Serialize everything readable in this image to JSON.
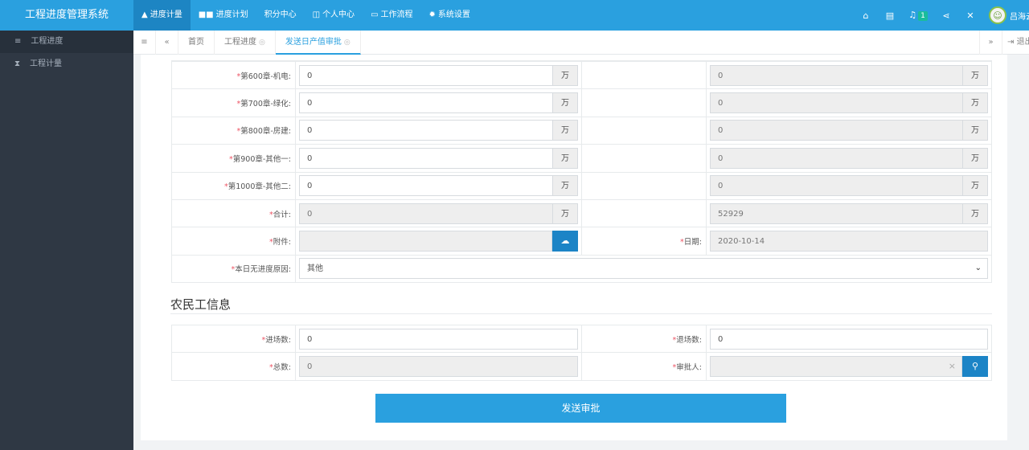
{
  "app": {
    "title": "工程进度管理系统"
  },
  "topnav": [
    {
      "label": "进度计量",
      "icon": "chart-icon",
      "glyph": "▲",
      "active": true
    },
    {
      "label": "进度计划",
      "icon": "grid-icon",
      "glyph": "■■",
      "active": false
    },
    {
      "label": "积分中心",
      "icon": "",
      "glyph": "",
      "active": false
    },
    {
      "label": "个人中心",
      "icon": "card-icon",
      "glyph": "◫",
      "active": false
    },
    {
      "label": "工作流程",
      "icon": "monitor-icon",
      "glyph": "▭",
      "active": false
    },
    {
      "label": "系统设置",
      "icon": "gear-icon",
      "glyph": "✹",
      "active": false
    }
  ],
  "header_right": {
    "notification_count": "1",
    "user_name": "吕海云"
  },
  "sidebar": {
    "items": [
      {
        "label": "工程进度",
        "icon": "list-icon",
        "glyph": "≡",
        "active": true
      },
      {
        "label": "工程计量",
        "icon": "hourglass-icon",
        "glyph": "⧗",
        "active": false
      }
    ]
  },
  "tabs": {
    "home": "首页",
    "items": [
      {
        "label": "工程进度",
        "active": false
      },
      {
        "label": "发送日产值审批",
        "active": true
      }
    ],
    "close_glyph": "◎",
    "logout": "退出"
  },
  "form": {
    "unit": "万",
    "rows": [
      {
        "label": "第600章-机电:",
        "value": "0",
        "compare": "0"
      },
      {
        "label": "第700章-绿化:",
        "value": "0",
        "compare": "0"
      },
      {
        "label": "第800章-房建:",
        "value": "0",
        "compare": "0"
      },
      {
        "label": "第900章-其他一:",
        "value": "0",
        "compare": "0"
      },
      {
        "label": "第1000章-其他二:",
        "value": "0",
        "compare": "0"
      },
      {
        "label": "合计:",
        "value": "0",
        "compare": "52929"
      }
    ],
    "attachment": {
      "label": "附件:",
      "value": ""
    },
    "date": {
      "label": "日期:",
      "value": "2020-10-14"
    },
    "reason": {
      "label": "本日无进度原因:",
      "value": "其他"
    }
  },
  "workers": {
    "title": "农民工信息",
    "entry": {
      "label": "进场数:",
      "value": "0"
    },
    "exit": {
      "label": "退场数:",
      "value": "0"
    },
    "total": {
      "label": "总数:",
      "value": "0"
    },
    "approver": {
      "label": "审批人:",
      "value": ""
    }
  },
  "submit_label": "发送审批"
}
